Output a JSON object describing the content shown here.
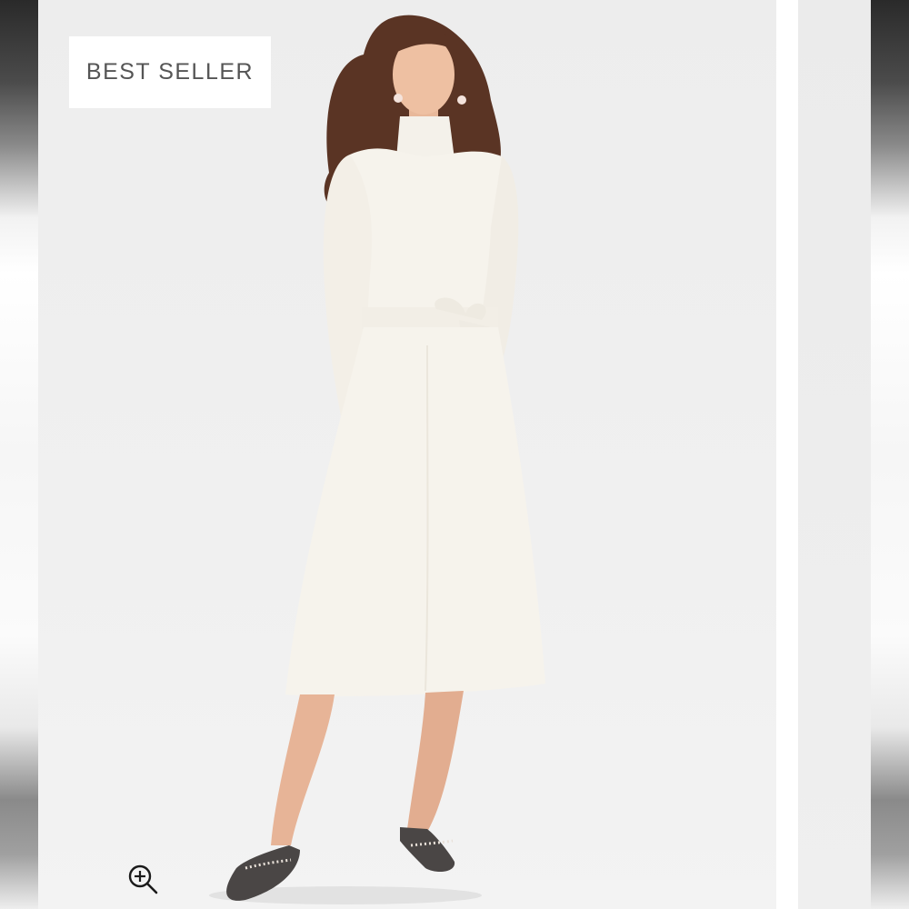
{
  "badge": {
    "label": "BEST SELLER"
  },
  "zoom": {
    "icon": "zoom-in-icon"
  },
  "colors": {
    "background": "#efefef",
    "garment": "#f5f2ea",
    "hair": "#5a3424",
    "shoes": "#4a4645",
    "skin": "#e8b89a"
  }
}
